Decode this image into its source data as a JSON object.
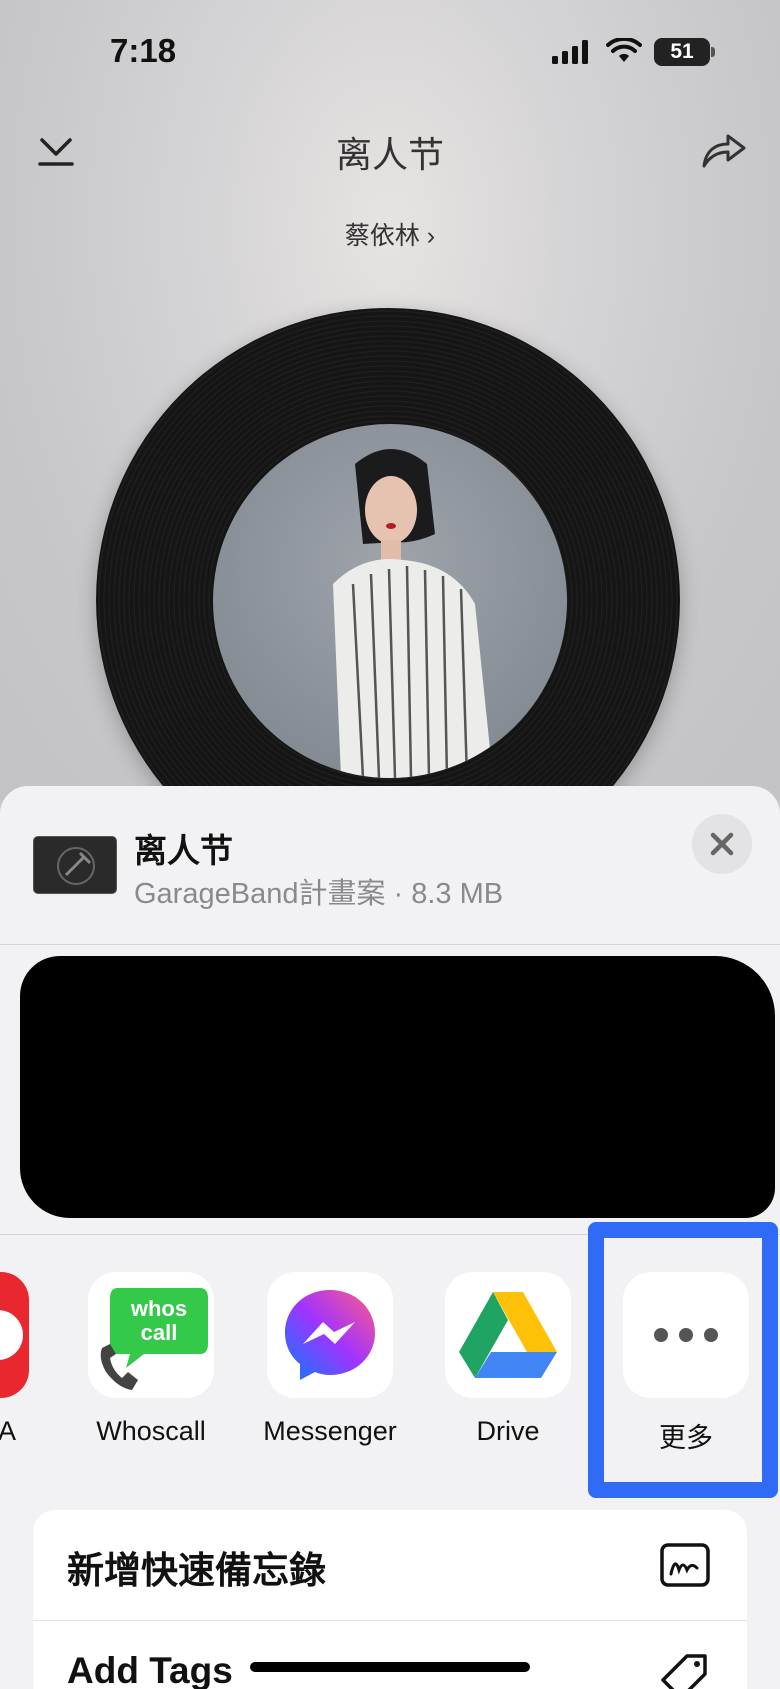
{
  "status_bar": {
    "time": "7:18",
    "battery": "51"
  },
  "player": {
    "title": "离人节",
    "artist": "蔡依林 ›",
    "icons": [
      "collapse-down-icon",
      "share-arrow-icon"
    ]
  },
  "share_sheet": {
    "file_name": "离人节",
    "file_meta": "GarageBand計畫案 · 8.3 MB",
    "close_icon": "close-icon",
    "apps": [
      {
        "label": "A",
        "icon": "partial-app-icon"
      },
      {
        "label": "Whoscall",
        "icon": "whoscall-icon",
        "icon_text": "whos call"
      },
      {
        "label": "Messenger",
        "icon": "messenger-icon"
      },
      {
        "label": "Drive",
        "icon": "google-drive-icon"
      },
      {
        "label": "更多",
        "icon": "more-icon"
      }
    ],
    "actions": [
      {
        "label": "新增快速備忘錄",
        "icon": "quick-note-icon"
      },
      {
        "label": "Add Tags",
        "icon": "tag-icon"
      }
    ]
  },
  "colors": {
    "highlight": "#2f6bf5",
    "whoscall_green": "#35c94a",
    "close_bg": "#e3e3e6"
  }
}
